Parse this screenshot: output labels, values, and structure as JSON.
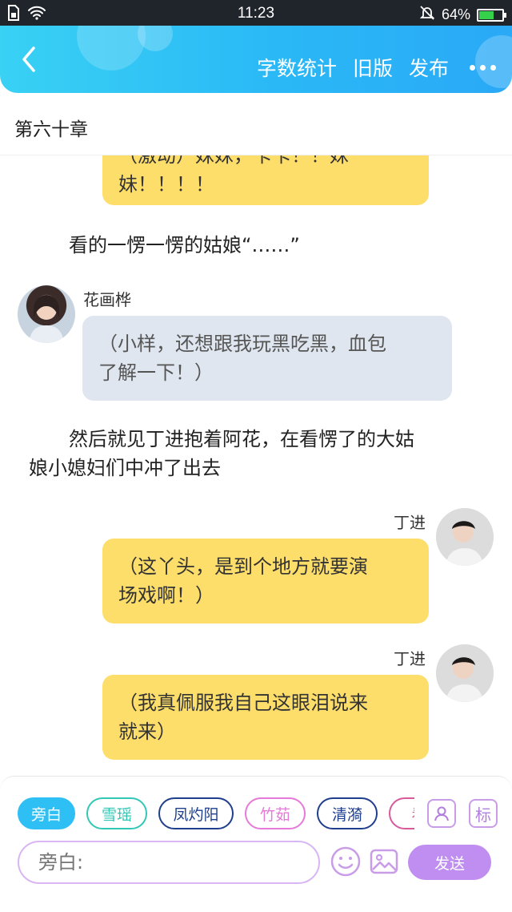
{
  "status_bar": {
    "time": "11:23",
    "battery_text": "64%",
    "battery_level": 0.64,
    "icons": [
      "sim-icon",
      "wifi-icon",
      "bell-mute-icon",
      "battery-icon"
    ]
  },
  "header": {
    "back_icon": "chevron-left-icon",
    "actions": [
      "字数统计",
      "旧版",
      "发布"
    ],
    "more_icon": "more-dots-icon"
  },
  "chapter": {
    "title": "第六十章"
  },
  "messages": {
    "m0_line1": "（激动）妹妹，卡卡！！妹",
    "m0_line2": "妹！！！！",
    "narr1": "看的一愣一愣的姑娘“……”",
    "m1_name": "花画桦",
    "m1_line1": "（小样，还想跟我玩黑吃黑，血包",
    "m1_line2": "了解一下！）",
    "narr2_line1": "然后就见丁进抱着阿花，在看愣了的大姑",
    "narr2_line2": "娘小媳妇们中冲了出去",
    "m2_name": "丁进",
    "m2_line1": "（这丫头，是到个地方就要演",
    "m2_line2": "场戏啊！）",
    "m3_name": "丁进",
    "m3_line1": "（我真佩服我自己这眼泪说来",
    "m3_line2": "就来）"
  },
  "composer": {
    "chips": [
      "旁白",
      "雪瑶",
      "凤灼阳",
      "竹茹",
      "清漪",
      "看"
    ],
    "chip_colors": [
      "#2ec0f5",
      "#33c7b6",
      "#1f3f8c",
      "#e57ad8",
      "#1f3f8c",
      "#d85a9a"
    ],
    "placeholder": "旁白:",
    "label_button": "标",
    "send_label": "发送"
  },
  "colors": {
    "header_gradient_start": "#39d1f4",
    "header_gradient_end": "#2aa9f6",
    "bubble_yellow": "#fede6a",
    "bubble_gray": "#dfe6ef",
    "send_button": "#bf8ef0"
  }
}
